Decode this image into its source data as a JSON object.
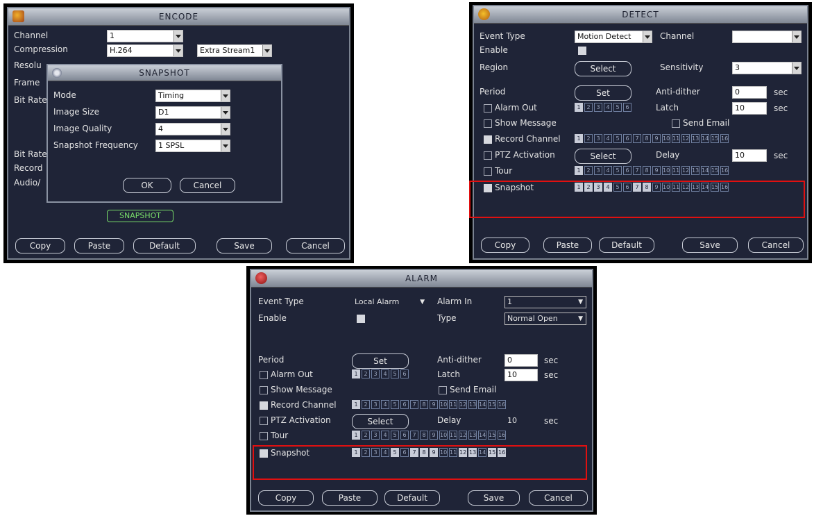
{
  "encode": {
    "title": "ENCODE",
    "labels": [
      "Channel",
      "Compression",
      "Resolu",
      "Frame",
      "Bit Rate",
      "",
      "Bit Rate",
      "Record",
      "Audio/"
    ],
    "channel_value": "1",
    "compression_value": "H.264",
    "extra_stream": "Extra Stream1",
    "snapshot_button": "SNAPSHOT",
    "buttons": [
      "Copy",
      "Paste",
      "Default",
      "Save",
      "Cancel"
    ],
    "dialog": {
      "title": "SNAPSHOT",
      "rows": [
        {
          "label": "Mode",
          "value": "Timing"
        },
        {
          "label": "Image Size",
          "value": "D1"
        },
        {
          "label": "Image Quality",
          "value": "4"
        },
        {
          "label": "Snapshot Frequency",
          "value": "1 SPSL"
        }
      ],
      "ok": "OK",
      "cancel": "Cancel"
    }
  },
  "detect": {
    "title": "DETECT",
    "event_type_label": "Event Type",
    "event_type_value": "Motion Detect",
    "channel_label": "Channel",
    "channel_value": "",
    "enable_label": "Enable",
    "region_label": "Region",
    "region_button": "Select",
    "sensitivity_label": "Sensitivity",
    "sensitivity_value": "3",
    "period_label": "Period",
    "period_button": "Set",
    "anti_label": "Anti-dither",
    "anti_value": "0",
    "anti_unit": "sec",
    "alarm_out_label": "Alarm Out",
    "latch_label": "Latch",
    "latch_value": "10",
    "latch_unit": "sec",
    "show_message_label": "Show Message",
    "send_email_label": "Send Email",
    "record_channel_label": "Record Channel",
    "ptz_label": "PTZ Activation",
    "ptz_button": "Select",
    "delay_label": "Delay",
    "delay_value": "10",
    "delay_unit": "sec",
    "tour_label": "Tour",
    "snapshot_label": "Snapshot",
    "alarm_out_channels": [
      "1",
      "2",
      "3",
      "4",
      "5",
      "6"
    ],
    "channels": [
      "1",
      "2",
      "3",
      "4",
      "5",
      "6",
      "7",
      "8",
      "9",
      "10",
      "11",
      "12",
      "13",
      "14",
      "15",
      "16"
    ],
    "buttons": [
      "Copy",
      "Paste",
      "Default",
      "Save",
      "Cancel"
    ]
  },
  "alarm": {
    "title": "ALARM",
    "event_type_label": "Event Type",
    "event_type_value": "Local Alarm",
    "alarm_in_label": "Alarm In",
    "alarm_in_value": "1",
    "enable_label": "Enable",
    "type_label": "Type",
    "type_value": "Normal Open",
    "period_label": "Period",
    "period_button": "Set",
    "anti_label": "Anti-dither",
    "anti_value": "0",
    "anti_unit": "sec",
    "alarm_out_label": "Alarm Out",
    "latch_label": "Latch",
    "latch_value": "10",
    "latch_unit": "sec",
    "show_message_label": "Show Message",
    "send_email_label": "Send Email",
    "record_channel_label": "Record Channel",
    "ptz_label": "PTZ Activation",
    "ptz_button": "Select",
    "delay_label": "Delay",
    "delay_value": "10",
    "delay_unit": "sec",
    "tour_label": "Tour",
    "snapshot_label": "Snapshot",
    "alarm_out_channels": [
      "1",
      "2",
      "3",
      "4",
      "5",
      "6"
    ],
    "channels": [
      "1",
      "2",
      "3",
      "4",
      "5",
      "6",
      "7",
      "8",
      "9",
      "10",
      "11",
      "12",
      "13",
      "14",
      "15",
      "16"
    ],
    "buttons": [
      "Copy",
      "Paste",
      "Default",
      "Save",
      "Cancel"
    ]
  },
  "colors": {
    "highlight": "#e01010",
    "panel": "#1f2437",
    "titlebar": "#b8bec8"
  }
}
